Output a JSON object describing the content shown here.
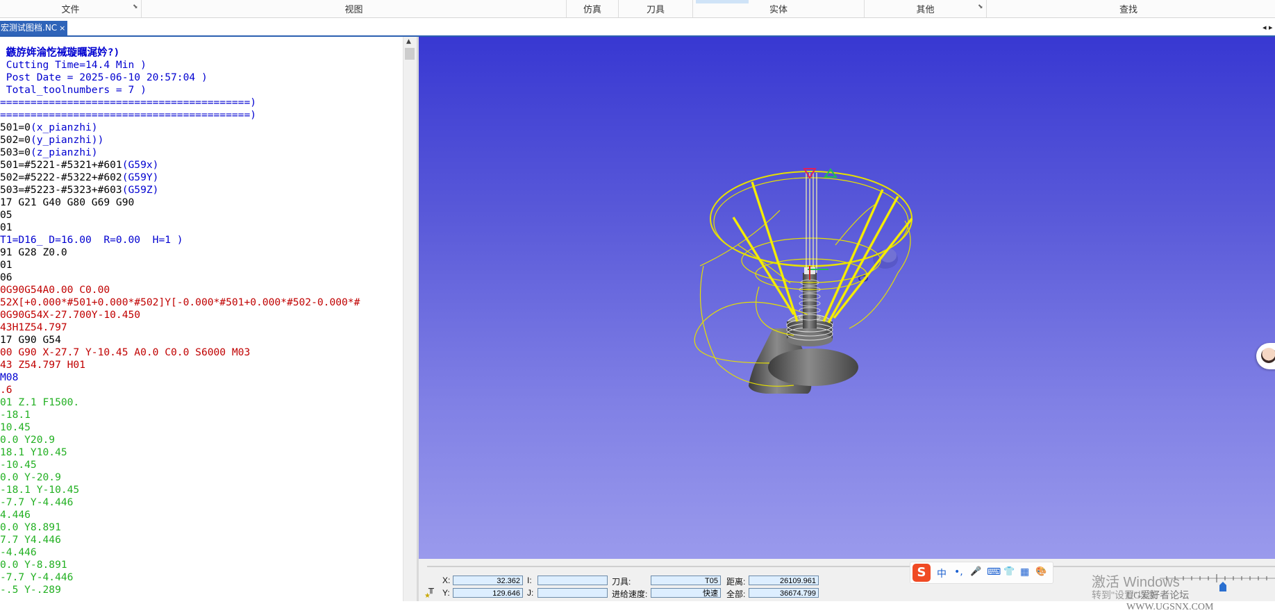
{
  "ribbon": {
    "groups": [
      "文件",
      "视图",
      "仿真",
      "刀具",
      "实体",
      "其他",
      "查找"
    ]
  },
  "tabs": {
    "doc_tab_label": "宏测试图档.NC",
    "doc_tab_close": "×",
    "nav_left": "◂",
    "nav_right": "▸"
  },
  "editor": {
    "lines": [
      {
        "text": " 鏃斿姩淪忔祴璇曞浘妗?)",
        "color": "#0000d0",
        "bold": true
      },
      {
        "text": " Cutting Time=14.4 Min )",
        "color": "#0000d0"
      },
      {
        "text": " Post Date = 2025-06-10 20:57:04 )",
        "color": "#0000d0"
      },
      {
        "text": " Total_toolnumbers = 7 )",
        "color": "#0000d0"
      },
      {
        "text": "=========================================)",
        "color": "#0000d0"
      },
      {
        "text": "=========================================)",
        "color": "#0000d0"
      },
      {
        "segs": [
          {
            "t": "501=0",
            "c": "#000"
          },
          {
            "t": "(x_pianzhi)",
            "c": "#0000d0"
          }
        ]
      },
      {
        "segs": [
          {
            "t": "502=0",
            "c": "#000"
          },
          {
            "t": "(y_pianzhi))",
            "c": "#0000d0"
          }
        ]
      },
      {
        "segs": [
          {
            "t": "503=0",
            "c": "#000"
          },
          {
            "t": "(z_pianzhi)",
            "c": "#0000d0"
          }
        ]
      },
      {
        "segs": [
          {
            "t": "501=#5221-#5321+#601",
            "c": "#000"
          },
          {
            "t": "(G59x)",
            "c": "#0000d0"
          }
        ]
      },
      {
        "segs": [
          {
            "t": "502=#5222-#5322+#602",
            "c": "#000"
          },
          {
            "t": "(G59Y)",
            "c": "#0000d0"
          }
        ]
      },
      {
        "segs": [
          {
            "t": "503=#5223-#5323+#603",
            "c": "#000"
          },
          {
            "t": "(G59Z)",
            "c": "#0000d0"
          }
        ]
      },
      {
        "text": "17 G21 G40 G80 G69 G90",
        "color": "#000"
      },
      {
        "text": "05",
        "color": "#000"
      },
      {
        "text": "01",
        "color": "#000"
      },
      {
        "text": "T1=D16_ D=16.00  R=0.00  H=1 )",
        "color": "#0000d0"
      },
      {
        "text": "91 G28 Z0.0",
        "color": "#000"
      },
      {
        "text": "01",
        "color": "#000"
      },
      {
        "text": "06",
        "color": "#000"
      },
      {
        "text": "0G90G54A0.00 C0.00",
        "color": "#c00000"
      },
      {
        "text": "52X[+0.000*#501+0.000*#502]Y[-0.000*#501+0.000*#502-0.000*#",
        "color": "#c00000"
      },
      {
        "text": "0G90G54X-27.700Y-10.450",
        "color": "#c00000"
      },
      {
        "text": "43H1Z54.797",
        "color": "#c00000"
      },
      {
        "text": "17 G90 G54",
        "color": "#000"
      },
      {
        "text": "00 G90 X-27.7 Y-10.45 A0.0 C0.0 S6000 M03",
        "color": "#c00000"
      },
      {
        "text": "43 Z54.797 H01",
        "color": "#c00000"
      },
      {
        "text": "M08",
        "color": "#0000d0"
      },
      {
        "text": ".6",
        "color": "#c00000"
      },
      {
        "text": "01 Z.1 F1500.",
        "color": "#22b022"
      },
      {
        "text": "-18.1",
        "color": "#22b022"
      },
      {
        "text": "10.45",
        "color": "#22b022"
      },
      {
        "text": "0.0 Y20.9",
        "color": "#22b022"
      },
      {
        "text": "18.1 Y10.45",
        "color": "#22b022"
      },
      {
        "text": "-10.45",
        "color": "#22b022"
      },
      {
        "text": "0.0 Y-20.9",
        "color": "#22b022"
      },
      {
        "text": "-18.1 Y-10.45",
        "color": "#22b022"
      },
      {
        "text": "-7.7 Y-4.446",
        "color": "#22b022"
      },
      {
        "text": "4.446",
        "color": "#22b022"
      },
      {
        "text": "0.0 Y8.891",
        "color": "#22b022"
      },
      {
        "text": "7.7 Y4.446",
        "color": "#22b022"
      },
      {
        "text": "-4.446",
        "color": "#22b022"
      },
      {
        "text": "0.0 Y-8.891",
        "color": "#22b022"
      },
      {
        "text": "-7.7 Y-4.446",
        "color": "#22b022"
      },
      {
        "text": "-.5 Y-.289",
        "color": "#22b022"
      }
    ]
  },
  "status": {
    "x_label": "X:",
    "x_value": "32.362",
    "y_label": "Y:",
    "y_value": "129.646",
    "i_label": "I:",
    "i_value": "",
    "j_label": "J:",
    "j_value": "",
    "tool_label": "刀具:",
    "tool_value": "T05",
    "feed_label": "进给速度:",
    "feed_value": "快速",
    "dist_label": "距离:",
    "dist_value": "26109.961",
    "total_label": "全部:",
    "total_value": "36674.799"
  },
  "ime": {
    "items": [
      "中",
      "•,",
      "🎤",
      "⌨",
      "👕",
      "▦",
      "🎨"
    ]
  },
  "watermark": {
    "line1": "激活 Windows",
    "line2": "转到\"设置\"以激",
    "line3": "UG爱好者论坛 WWW.UGSNX.COM"
  },
  "colors": {
    "viewport_top": "#3838d2",
    "viewport_bottom": "#9a9aec",
    "toolpath": "#e6e000",
    "doc_tab": "#2f64b9"
  }
}
